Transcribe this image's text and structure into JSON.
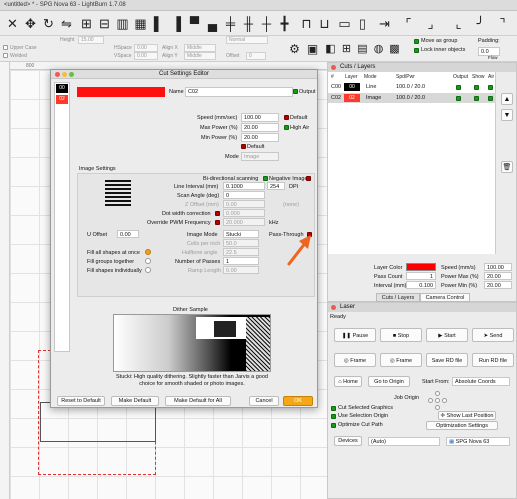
{
  "window": {
    "title": "<untitled> * - SPG Nova 63 - LightBurn 1.7.08"
  },
  "optionbar": {
    "upper_case": "Upper Case",
    "welded": "Welded",
    "height_label": "Height",
    "height_value": "15.00",
    "hspace_label": "HSpace",
    "hspace_value": "0.00",
    "align_x_label": "Align X",
    "align_x_value": "Middle",
    "normal_value": "Normal",
    "vspace_label": "VSpace",
    "vspace_value": "0.00",
    "align_y_label": "Align Y",
    "align_y_value": "Middle",
    "offset_label": "Offset",
    "offset_value": "0",
    "move_as_group": "Move as group",
    "lock_inner_objects": "Lock inner objects",
    "padding_label": "Padding:",
    "padding_value": "0.0",
    "flow_label": "Flow"
  },
  "ruler": {
    "h_ticks": [
      "800",
      "750",
      "700",
      "650",
      "600",
      "550",
      "500",
      "450",
      "400",
      "350",
      "300"
    ],
    "v_ticks": [
      "600",
      "550",
      "500",
      "450",
      "400",
      "350",
      "300",
      "250",
      "200"
    ]
  },
  "dialog": {
    "title": "Cut Settings Editor",
    "layers": [
      "00",
      "02"
    ],
    "name_label": "Name",
    "name_value": "C02",
    "output_label": "Output",
    "speed_label": "Speed (mm/sec)",
    "speed_value": "100.00",
    "default_label": "Default",
    "max_power_label": "Max Power (%)",
    "max_power_value": "20.00",
    "high_air_label": "High Air",
    "min_power_label": "Min Power (%)",
    "min_power_value": "20.00",
    "default2_label": "Default",
    "mode_label": "Mode",
    "mode_value": "Image",
    "image_settings_label": "Image Settings",
    "bidirectional_label": "Bi-directional scanning",
    "negative_label": "Negative Image",
    "interval_label": "Line Interval (mm)",
    "interval_value": "0.1000",
    "dpi_value": "254",
    "dpi_label": "DPI",
    "scan_angle_label": "Scan Angle (deg)",
    "scan_angle_value": "0",
    "z_offset_label": "Z Offset (mm)",
    "z_offset_value": "0.00",
    "none_label": "(none)",
    "dot_width_label": "Dot width correction",
    "dot_width_value": "0.000",
    "override_pwm_label": "Override PWM Frequency",
    "override_pwm_value": "20.000",
    "khz_label": "kHz",
    "u_offset_label": "U Offset",
    "u_offset_value": "0.00",
    "image_mode_label": "Image Mode",
    "image_mode_value": "Stucki",
    "pass_through_label": "Pass-Through",
    "cells_per_inch_label": "Cells per inch",
    "cells_per_inch_value": "50.0",
    "halftone_angle_label": "Halftone angle",
    "halftone_angle_value": "22.5",
    "passes_label": "Number of Passes",
    "passes_value": "1",
    "ramp_length_label": "Ramp Length",
    "ramp_length_value": "0.00",
    "fill_all_label": "Fill all shapes at once",
    "fill_groups_label": "Fill groups together",
    "fill_individually_label": "Fill shapes individually",
    "dither_title": "Dither Sample",
    "dither_desc": "Stucki: High quality dithering. Slightly faster than Jarvis a good choice for smooth shaded or photo images.",
    "reset_btn": "Reset to Default",
    "make_default_btn": "Make Default",
    "make_default_all_btn": "Make Default for All",
    "cancel_btn": "Cancel",
    "ok_btn": "OK"
  },
  "cuts": {
    "title": "Cuts / Layers",
    "headers": [
      "#",
      "Layer",
      "Mode",
      "Spd/Pwr",
      "Output",
      "Show",
      "Air"
    ],
    "rows": [
      {
        "num": "C00",
        "layer": "00",
        "mode": "Line",
        "spdpwr": "100.0 / 20.0"
      },
      {
        "num": "C02",
        "layer": "02",
        "mode": "Image",
        "spdpwr": "100.0 / 20.0"
      }
    ],
    "layer_color_label": "Layer Color",
    "speed_label": "Speed (mm/s)",
    "speed_value": "100.00",
    "pass_count_label": "Pass Count",
    "pass_count_value": "1",
    "max_power_label": "Power Max (%)",
    "max_power_value": "20.00",
    "interval_label": "Interval (mm)",
    "interval_value": "0.100",
    "min_power_label": "Power Min (%)",
    "min_power_value": "20.00",
    "tab_cuts": "Cuts / Layers",
    "tab_camera": "Camera Control",
    "colors": {
      "c00": "#000000",
      "c02": "#ff2a1a",
      "layer_color": "#ff0000"
    }
  },
  "laser": {
    "title": "Laser",
    "status": "Ready",
    "pause": "Pause",
    "stop": "Stop",
    "start": "Start",
    "send": "Send",
    "frame1": "Frame",
    "frame2": "Frame",
    "save_rd": "Save RD file",
    "run_rd": "Run RD file",
    "home": "Home",
    "go_to_origin": "Go to Origin",
    "start_from_label": "Start From:",
    "start_from_value": "Absolute Coords",
    "job_origin_label": "Job Origin",
    "cut_selected": "Cut Selected Graphics",
    "use_selection_origin": "Use Selection Origin",
    "show_last_position": "Show Last Position",
    "optimize_cut_path": "Optimize Cut Path",
    "optimization_settings": "Optimization Settings",
    "devices_btn": "Devices",
    "device_auto": "(Auto)",
    "device_name": "SPG Nova 63"
  }
}
